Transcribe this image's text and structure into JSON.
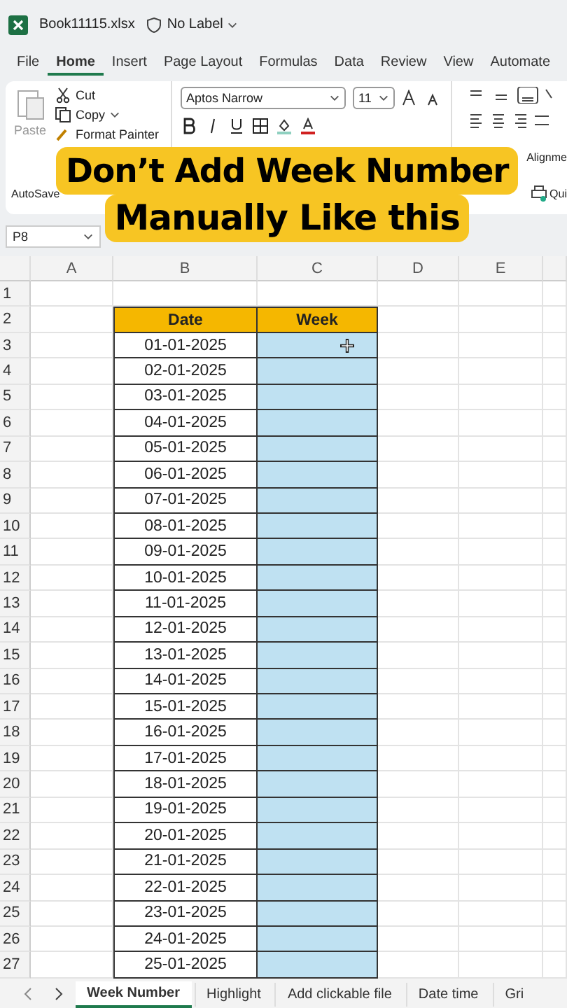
{
  "title_bar": {
    "file_name": "Book11115.xlsx",
    "label": "No Label"
  },
  "menu_tabs": [
    {
      "label": "File",
      "selected": false
    },
    {
      "label": "Home",
      "selected": true
    },
    {
      "label": "Insert",
      "selected": false
    },
    {
      "label": "Page Layout",
      "selected": false
    },
    {
      "label": "Formulas",
      "selected": false
    },
    {
      "label": "Data",
      "selected": false
    },
    {
      "label": "Review",
      "selected": false
    },
    {
      "label": "View",
      "selected": false
    },
    {
      "label": "Automate",
      "selected": false
    }
  ],
  "ribbon": {
    "paste": "Paste",
    "cut": "Cut",
    "copy": "Copy",
    "format_painter": "Format Painter",
    "font_name": "Aptos Narrow",
    "font_size": "11",
    "alignment": "Alignme",
    "autosave": "AutoSave",
    "quick": "Qui"
  },
  "caption": [
    "Don’t Add Week Number",
    "Manually Like this"
  ],
  "name_box": "P8",
  "columns": [
    "A",
    "B",
    "C",
    "D",
    "E"
  ],
  "rows": [
    {
      "num": "1",
      "kind": "empty"
    },
    {
      "num": "2",
      "kind": "header",
      "b": "Date",
      "c": "Week"
    },
    {
      "num": "3",
      "kind": "data",
      "b": "01-01-2025"
    },
    {
      "num": "4",
      "kind": "data",
      "b": "02-01-2025"
    },
    {
      "num": "5",
      "kind": "data",
      "b": "03-01-2025"
    },
    {
      "num": "6",
      "kind": "data",
      "b": "04-01-2025"
    },
    {
      "num": "7",
      "kind": "data",
      "b": "05-01-2025"
    },
    {
      "num": "8",
      "kind": "data",
      "b": "06-01-2025"
    },
    {
      "num": "9",
      "kind": "data",
      "b": "07-01-2025"
    },
    {
      "num": "10",
      "kind": "data",
      "b": "08-01-2025"
    },
    {
      "num": "11",
      "kind": "data",
      "b": "09-01-2025"
    },
    {
      "num": "12",
      "kind": "data",
      "b": "10-01-2025"
    },
    {
      "num": "13",
      "kind": "data",
      "b": "11-01-2025"
    },
    {
      "num": "14",
      "kind": "data",
      "b": "12-01-2025"
    },
    {
      "num": "15",
      "kind": "data",
      "b": "13-01-2025"
    },
    {
      "num": "16",
      "kind": "data",
      "b": "14-01-2025"
    },
    {
      "num": "17",
      "kind": "data",
      "b": "15-01-2025"
    },
    {
      "num": "18",
      "kind": "data",
      "b": "16-01-2025"
    },
    {
      "num": "19",
      "kind": "data",
      "b": "17-01-2025"
    },
    {
      "num": "20",
      "kind": "data",
      "b": "18-01-2025"
    },
    {
      "num": "21",
      "kind": "data",
      "b": "19-01-2025"
    },
    {
      "num": "22",
      "kind": "data",
      "b": "20-01-2025"
    },
    {
      "num": "23",
      "kind": "data",
      "b": "21-01-2025"
    },
    {
      "num": "24",
      "kind": "data",
      "b": "22-01-2025"
    },
    {
      "num": "25",
      "kind": "data",
      "b": "23-01-2025"
    },
    {
      "num": "26",
      "kind": "data",
      "b": "24-01-2025"
    },
    {
      "num": "27",
      "kind": "data",
      "b": "25-01-2025"
    }
  ],
  "sheet_tabs": [
    {
      "label": "Week Number",
      "selected": true
    },
    {
      "label": "Highlight",
      "selected": false
    },
    {
      "label": "Add clickable file",
      "selected": false
    },
    {
      "label": "Date time",
      "selected": false
    },
    {
      "label": "Gri",
      "selected": false
    }
  ]
}
